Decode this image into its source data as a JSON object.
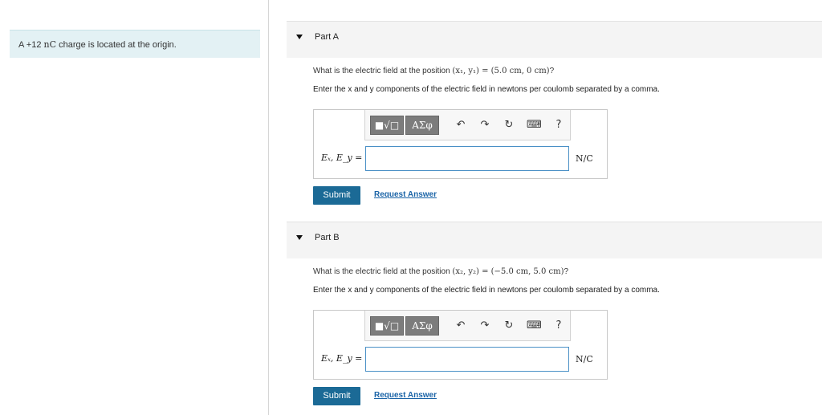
{
  "problem": {
    "prefix": "A +12 ",
    "unit_math": "nC",
    "suffix": " charge is located at the origin."
  },
  "parts": [
    {
      "title": "Part A",
      "question_prefix": "What is the electric field at the position ",
      "question_math": "(x₁, y₁) = (5.0 cm, 0 cm)",
      "question_suffix": "?",
      "instruction": "Enter the x and y components of the electric field in newtons per coulomb separated by a comma.",
      "input_label": "Eₓ, E_y",
      "input_eq": " =",
      "input_value": "",
      "unit": "N/C",
      "submit_label": "Submit",
      "request_label": "Request Answer"
    },
    {
      "title": "Part B",
      "question_prefix": "What is the electric field at the position ",
      "question_math": "(x₂, y₂) = (−5.0 cm, 5.0 cm)",
      "question_suffix": "?",
      "instruction": "Enter the x and y components of the electric field in newtons per coulomb separated by a comma.",
      "input_label": "Eₓ, E_y",
      "input_eq": " =",
      "input_value": "",
      "unit": "N/C",
      "submit_label": "Submit",
      "request_label": "Request Answer"
    }
  ],
  "toolbar": {
    "templates_label": "■√□",
    "symbols_label": "ΑΣφ",
    "undo_glyph": "↶",
    "redo_glyph": "↷",
    "reset_glyph": "↻",
    "keyboard_glyph": "⌨",
    "help_glyph": "?"
  },
  "colors": {
    "problem_bg": "#e3f1f4",
    "header_bg": "#f4f4f4",
    "submit_bg": "#1b6a96",
    "link": "#1b64a7",
    "input_border": "#4a90c6"
  }
}
